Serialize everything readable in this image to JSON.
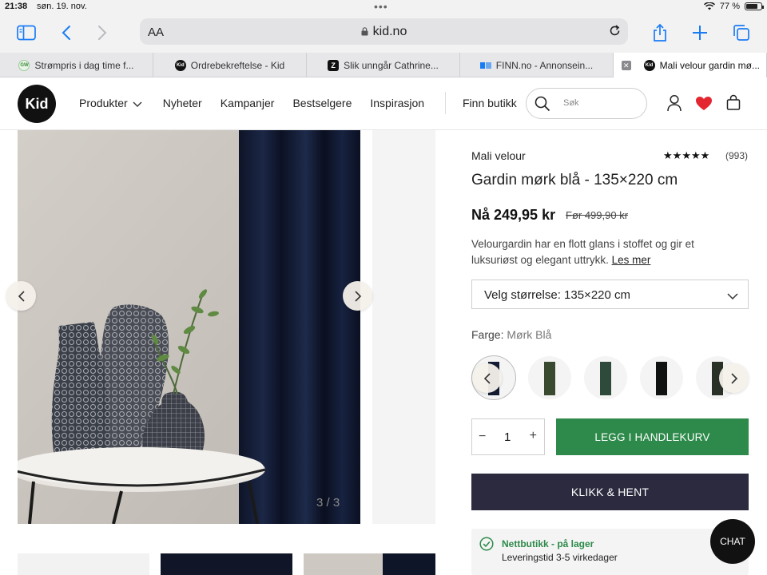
{
  "status_bar": {
    "time": "21:38",
    "date": "søn. 19. nov.",
    "battery": "77 %"
  },
  "browser": {
    "address_font_label": "AA",
    "host": "kid.no",
    "tabs": [
      {
        "title": "Strømpris i dag time f...",
        "favicon": "gw-icon"
      },
      {
        "title": "Ordrebekreftelse - Kid",
        "favicon": "kid-icon"
      },
      {
        "title": "Slik unngår Cathrine...",
        "favicon": "z-icon"
      },
      {
        "title": "FINN.no - Annonsein...",
        "favicon": "finn-icon"
      },
      {
        "title": "Mali velour gardin mø...",
        "favicon": "kid-icon",
        "active": true
      }
    ]
  },
  "site": {
    "logo": "Kid",
    "nav": [
      "Produkter",
      "Nyheter",
      "Kampanjer",
      "Bestselgere",
      "Inspirasjon"
    ],
    "find_store": "Finn butikk",
    "search_placeholder": "Søk"
  },
  "gallery": {
    "counter": "3 / 3"
  },
  "product": {
    "brand": "Mali velour",
    "rating_stars": 5,
    "review_count": "(993)",
    "title": "Gardin mørk blå - 135×220 cm",
    "price": "Nå 249,95 kr",
    "old_price": "Før 499,90 kr",
    "description": "Velourgardin har en flott glans i stoffet og gir et luksuriøst og elegant uttrykk.",
    "read_more": "Les mer",
    "size_select": "Velg størrelse: 135×220 cm",
    "color_label": "Farge:",
    "color_value": "Mørk Blå",
    "swatches": [
      "#141c33",
      "#3a4a30",
      "#2e4a3a",
      "#0f1210",
      "#2a3228"
    ],
    "quantity": "1",
    "add_to_cart": "LEGG I HANDLEKURV",
    "click_collect": "KLIKK & HENT",
    "stock_title": "Nettbutikk - på lager",
    "stock_delivery": "Leveringstid 3-5 virkedager"
  },
  "chat": "CHAT",
  "colors": {
    "green": "#2d8a4a",
    "dark_button": "#2b2a3f",
    "heart": "#e3262f",
    "ios_blue": "#1a7cf5"
  }
}
